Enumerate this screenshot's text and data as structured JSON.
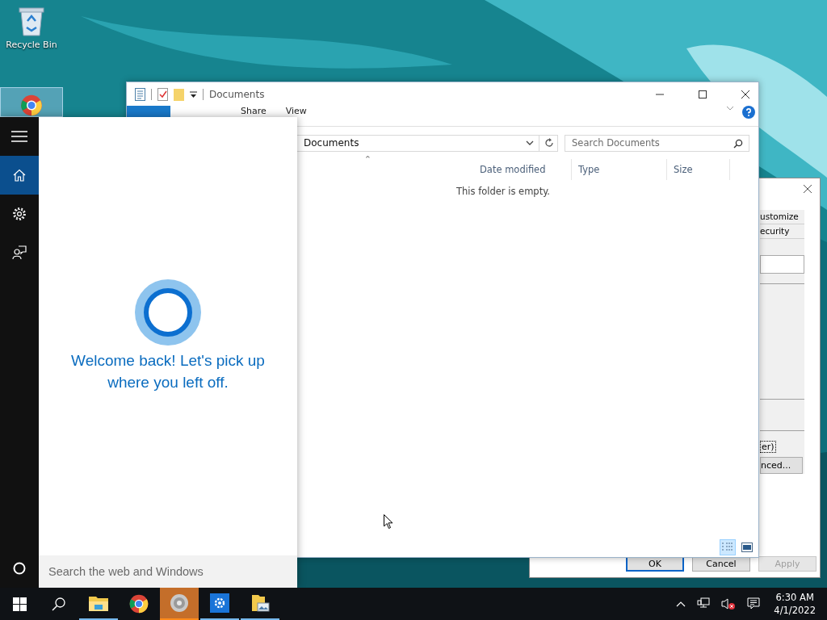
{
  "desktop": {
    "icons": [
      {
        "kind": "recycle",
        "label": "Recycle Bin",
        "selected": false
      },
      {
        "kind": "browser",
        "selected": true
      }
    ]
  },
  "properties_dialog": {
    "tabs": [
      {
        "label": "ustomize"
      },
      {
        "label": "ecurity"
      }
    ],
    "checkbox_label": "er)",
    "side_button": "nced...",
    "buttons": [
      {
        "label": "OK",
        "kind": "default",
        "disabled": false
      },
      {
        "label": "Cancel",
        "kind": "normal",
        "disabled": false
      },
      {
        "label": "Apply",
        "kind": "normal",
        "disabled": true
      }
    ]
  },
  "explorer": {
    "title": "Documents",
    "ribbon_tabs": [
      {
        "label": "Share",
        "selected": false
      },
      {
        "label": "View",
        "selected": false
      }
    ],
    "address": {
      "path": "Documents"
    },
    "search": {
      "placeholder": "Search Documents"
    },
    "sort_indicator": "⌃",
    "columns": [
      "Date modified",
      "Type",
      "Size"
    ],
    "empty_message": "This folder is empty.",
    "view_buttons": [
      {
        "kind": "details",
        "selected": true
      },
      {
        "kind": "large-icons",
        "selected": false
      }
    ]
  },
  "cortana": {
    "nav": [
      {
        "kind": "menu",
        "selected": false
      },
      {
        "kind": "home",
        "selected": true
      },
      {
        "kind": "settings",
        "selected": false
      },
      {
        "kind": "feedback",
        "selected": false
      }
    ],
    "greeting": "Welcome back! Let's pick up where you left off.",
    "search": {
      "placeholder": "Search the web and Windows"
    }
  },
  "taskbar": {
    "apps": [
      {
        "kind": "explorer",
        "running": true,
        "active": false
      },
      {
        "kind": "chrome",
        "running": false,
        "active": false
      },
      {
        "kind": "speaker",
        "running": true,
        "active": true
      },
      {
        "kind": "settings",
        "running": true,
        "active": false
      },
      {
        "kind": "pictures",
        "running": true,
        "active": false
      }
    ],
    "volume_muted": true,
    "clock": {
      "time": "6:30 AM",
      "date": "4/1/2022"
    }
  }
}
